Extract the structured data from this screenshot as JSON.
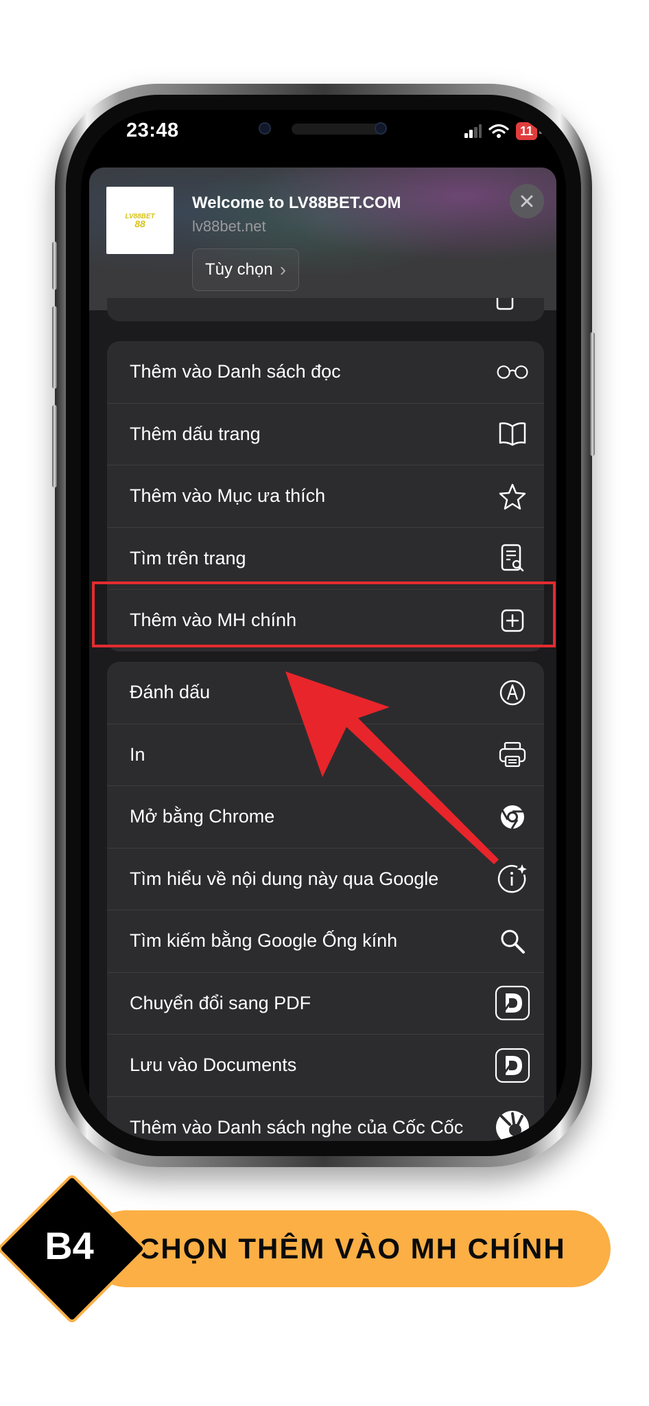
{
  "status_bar": {
    "time": "23:48",
    "battery": "11"
  },
  "share_header": {
    "logo_text_1": "LV88BET",
    "logo_text_2": "88",
    "title": "Welcome to LV88BET.COM",
    "url": "lv88bet.net",
    "options_label": "Tùy chọn",
    "options_chevron": "›"
  },
  "menu_group_1": [
    {
      "label": "Thêm vào Danh sách đọc",
      "icon": "glasses-icon"
    },
    {
      "label": "Thêm dấu trang",
      "icon": "book-icon"
    },
    {
      "label": "Thêm vào Mục ưa thích",
      "icon": "star-icon"
    },
    {
      "label": "Tìm trên trang",
      "icon": "find-in-page-icon"
    },
    {
      "label": "Thêm vào MH chính",
      "icon": "add-square-icon"
    }
  ],
  "menu_group_2": [
    {
      "label": "Đánh dấu",
      "icon": "markup-pen-icon"
    },
    {
      "label": "In",
      "icon": "printer-icon"
    },
    {
      "label": "Mở bằng Chrome",
      "icon": "chrome-icon"
    },
    {
      "label": "Tìm hiểu về nội dung này qua Google",
      "icon": "info-sparkle-icon"
    },
    {
      "label": "Tìm kiếm bằng Google Ống kính",
      "icon": "search-icon"
    },
    {
      "label": "Chuyển đổi sang PDF",
      "icon": "documents-app-icon"
    },
    {
      "label": "Lưu vào Documents",
      "icon": "documents-app-icon"
    },
    {
      "label": "Thêm vào Danh sách nghe của Cốc Cốc",
      "icon": "coccoc-icon"
    }
  ],
  "step_banner": {
    "step": "B4",
    "text": "CHỌN THÊM VÀO MH CHÍNH"
  },
  "colors": {
    "highlight": "#e32b2f",
    "arrow": "#e8252b",
    "banner": "#fbaf45"
  }
}
